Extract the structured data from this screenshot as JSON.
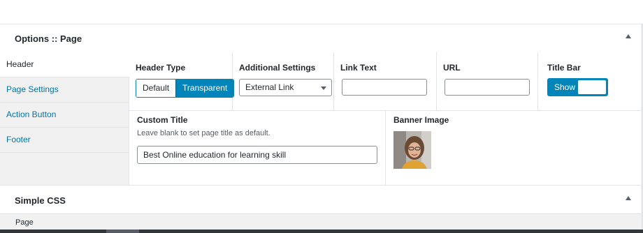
{
  "panel": {
    "title": "Options :: Page",
    "tabs": [
      {
        "label": "Header",
        "active": true
      },
      {
        "label": "Page Settings",
        "active": false
      },
      {
        "label": "Action Button",
        "active": false
      },
      {
        "label": "Footer",
        "active": false
      }
    ]
  },
  "header_type": {
    "label": "Header Type",
    "options": [
      "Default",
      "Transparent"
    ],
    "selected": "Transparent"
  },
  "additional_settings": {
    "label": "Additional Settings",
    "selected": "External Link"
  },
  "link_text": {
    "label": "Link Text",
    "value": ""
  },
  "url": {
    "label": "URL",
    "value": ""
  },
  "title_bar": {
    "label": "Title Bar",
    "state_label": "Show",
    "on": true
  },
  "custom_title": {
    "label": "Custom Title",
    "description": "Leave blank to set page title as default.",
    "value": "Best Online education for learning skill"
  },
  "banner_image": {
    "label": "Banner Image"
  },
  "panel2": {
    "title": "Simple CSS"
  },
  "footer_text": "Page",
  "colors": {
    "accent": "#0085ba",
    "link": "#0073aa"
  },
  "icons": {
    "panel_toggle": "triangle-up-icon",
    "select_caret": "caret-down-icon"
  }
}
